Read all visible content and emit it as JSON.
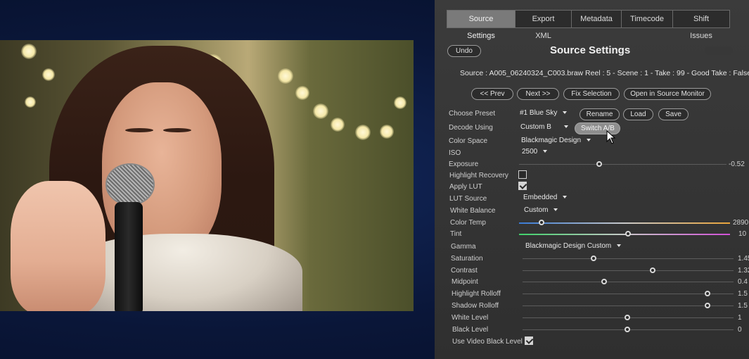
{
  "tabs": [
    {
      "label": "Source Settings",
      "active": true
    },
    {
      "label": "Export XML",
      "active": false
    },
    {
      "label": "Metadata",
      "active": false
    },
    {
      "label": "Timecode",
      "active": false
    },
    {
      "label": "Shift Issues",
      "active": false
    }
  ],
  "header": {
    "undo_label": "Undo",
    "title": "Source Settings",
    "source_info": "Source : A005_06240324_C003.braw  Reel : 5 - Scene : 1 - Take : 99 - Good Take : False"
  },
  "nav": {
    "prev_label": "<< Prev",
    "next_label": "Next >>",
    "fix_label": "Fix Selection",
    "open_label": "Open in Source Monitor"
  },
  "preset": {
    "label": "Choose Preset",
    "value": "#1 Blue Sky",
    "rename_label": "Rename",
    "load_label": "Load",
    "save_label": "Save"
  },
  "decode": {
    "label": "Decode Using",
    "value": "Custom B",
    "switch_label": "Switch A/B"
  },
  "color_space": {
    "label": "Color Space",
    "value": "Blackmagic Design"
  },
  "iso": {
    "label": "ISO",
    "value": "2500"
  },
  "exposure": {
    "label": "Exposure",
    "value": "-0.52",
    "level": 0.39
  },
  "highlight_recovery": {
    "label": "Highlight Recovery",
    "checked": false
  },
  "apply_lut": {
    "label": "Apply LUT",
    "checked": true
  },
  "lut_source": {
    "label": "LUT Source",
    "value": "Embedded"
  },
  "white_balance": {
    "label": "White Balance",
    "value": "Custom"
  },
  "color_temp": {
    "label": "Color Temp",
    "value": "2890",
    "level": 0.11
  },
  "tint": {
    "label": "Tint",
    "value": "10",
    "level": 0.52
  },
  "gamma": {
    "label": "Gamma",
    "value": "Blackmagic Design Custom"
  },
  "sliders": [
    {
      "key": "saturation",
      "label": "Saturation",
      "value": "1.45",
      "level": 0.34
    },
    {
      "key": "contrast",
      "label": "Contrast",
      "value": "1.32",
      "level": 0.62
    },
    {
      "key": "midpoint",
      "label": "Midpoint",
      "value": "0.4",
      "level": 0.39
    },
    {
      "key": "highlight_rolloff",
      "label": "Highlight Rolloff",
      "value": "1.5",
      "level": 0.88
    },
    {
      "key": "shadow_rolloff",
      "label": "Shadow Rolloff",
      "value": "1.5",
      "level": 0.88
    },
    {
      "key": "white_level",
      "label": "White Level",
      "value": "1",
      "level": 0.5
    },
    {
      "key": "black_level",
      "label": "Black Level",
      "value": "0",
      "level": 0.5
    }
  ],
  "use_video_black_level": {
    "label": "Use Video Black Level",
    "checked": true
  },
  "colors": {
    "panel_bg": "#333333",
    "background": "#0b1a3d",
    "temp_gradient_start": "#3a7bd5",
    "temp_gradient_end": "#e8a33a",
    "tint_gradient_start": "#3fd06a",
    "tint_gradient_end": "#d04fd6"
  }
}
